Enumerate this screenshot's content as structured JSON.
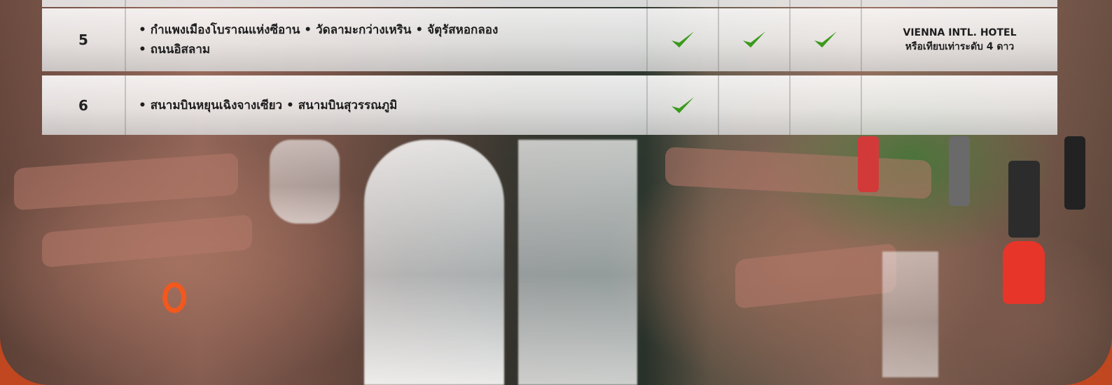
{
  "rows": [
    {
      "day": "5",
      "description_lines": [
        "• กำแพงเมืองโบราณแห่งซีอาน • วัดลามะกว่างเหริน • จัตุรัสหอกลอง",
        "• ถนนอิสลาม"
      ],
      "meals": {
        "breakfast": true,
        "lunch": true,
        "dinner": true
      },
      "hotel_line1": "VIENNA INTL. HOTEL",
      "hotel_line2": "หรือเทียบเท่าระดับ 4 ดาว"
    },
    {
      "day": "6",
      "description_lines": [
        "• สนามบินหยุนเฉิงจางเซียว • สนามบินสุวรรณภูมิ"
      ],
      "meals": {
        "breakfast": true,
        "lunch": false,
        "dinner": false
      },
      "hotel_line1": "",
      "hotel_line2": ""
    }
  ],
  "icons": {
    "meal_included": "check-icon"
  },
  "colors": {
    "check": "#3a9a1c",
    "frame": "#c0471f",
    "cell_bg": "#f2f2f2"
  }
}
